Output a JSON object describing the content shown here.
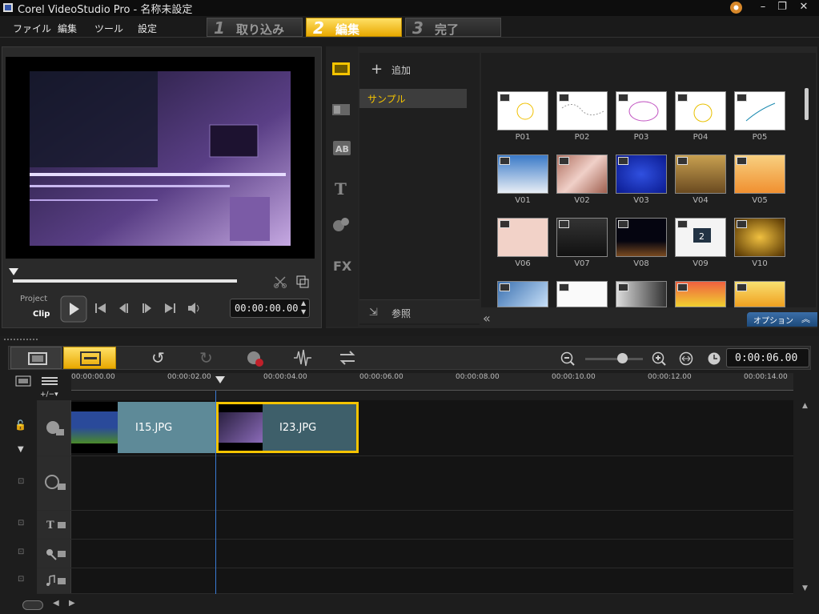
{
  "window": {
    "title": "Corel VideoStudio Pro - 名称未設定"
  },
  "menu": [
    "ファイル",
    "編集",
    "ツール",
    "設定"
  ],
  "steps": [
    {
      "num": "1",
      "label": "取り込み",
      "active": false
    },
    {
      "num": "2",
      "label": "編集",
      "active": true
    },
    {
      "num": "3",
      "label": "完了",
      "active": false
    }
  ],
  "player": {
    "project_label": "Project",
    "clip_label": "Clip",
    "timecode": "00:00:00.00"
  },
  "library": {
    "add_label": "追加",
    "selected_folder": "サンプル",
    "browse_label": "参照",
    "options_label": "オプション",
    "items": [
      "P01",
      "P02",
      "P03",
      "P04",
      "P05",
      "V01",
      "V02",
      "V03",
      "V04",
      "V05",
      "V06",
      "V07",
      "V08",
      "V09",
      "V10"
    ],
    "tab_icons": [
      "media-icon",
      "transition-icon",
      "ab-title-icon",
      "text-icon",
      "filter-icon",
      "fx-icon"
    ]
  },
  "timeline": {
    "duration": "0:00:06.00",
    "ticks": [
      "00:00:00.00",
      "00:00:02.00",
      "00:00:04.00",
      "00:00:06.00",
      "00:00:08.00",
      "00:00:10.00",
      "00:00:12.00",
      "00:00:14.00"
    ],
    "clips": [
      {
        "label": "I15.JPG"
      },
      {
        "label": "I23.JPG"
      }
    ]
  },
  "colors": {
    "accent_yellow": "#f5c400",
    "clip_teal": "#5e8a98",
    "playhead_blue": "#3a7bd5"
  }
}
